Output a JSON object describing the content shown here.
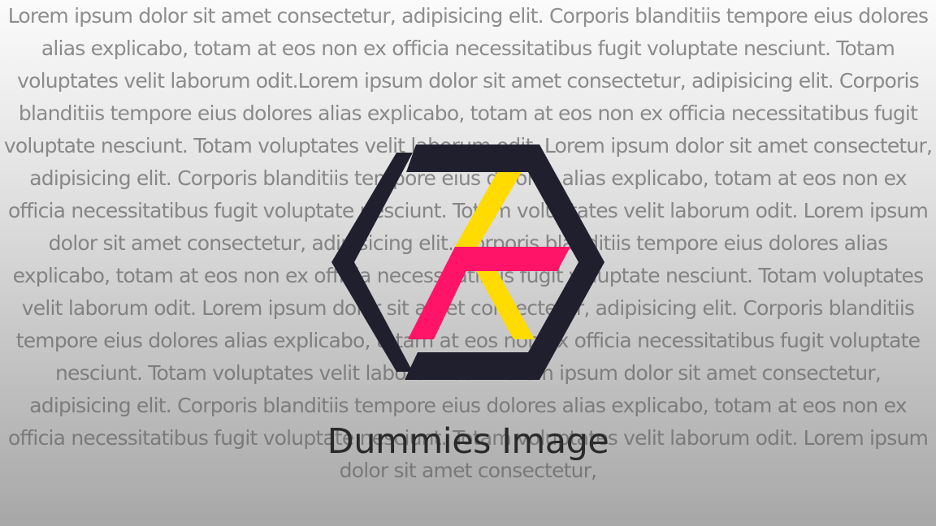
{
  "background_text": "Lorem ipsum dolor sit amet consectetur, adipisicing elit. Corporis blanditiis tempore eius dolores alias explicabo, totam at eos non ex officia necessitatibus fugit voluptate nesciunt. Totam voluptates velit laborum odit.Lorem ipsum dolor sit amet consectetur, adipisicing elit. Corporis blanditiis tempore eius dolores alias explicabo, totam at eos non ex officia necessitatibus fugit voluptate nesciunt. Totam voluptates velit laborum odit. Lorem ipsum dolor sit amet consectetur, adipisicing elit. Corporis blanditiis tempore eius dolores alias explicabo, totam at eos non ex officia necessitatibus fugit voluptate nesciunt. Totam voluptates velit laborum odit. Lorem ipsum dolor sit amet consectetur, adipisicing elit. Corporis blanditiis tempore eius dolores alias explicabo, totam at eos non ex officia necessitatibus fugit voluptate nesciunt. Totam voluptates velit laborum odit. Lorem ipsum dolor sit amet consectetur, adipisicing elit. Corporis blanditiis tempore eius dolores alias explicabo, totam at eos non ex officia necessitatibus fugit voluptate nesciunt. Totam voluptates velit laborum odit.Lorem ipsum dolor sit amet consectetur, adipisicing elit. Corporis blanditiis tempore eius dolores alias explicabo, totam at eos non ex officia necessitatibus fugit voluptate nesciunt. Totam voluptates velit laborum odit. Lorem ipsum dolor sit amet consectetur,",
  "caption": "Dummies Image",
  "logo": {
    "icon": "hexagon-logo-icon",
    "colors": {
      "dark": "#1f1f2e",
      "yellow": "#ffdb00",
      "pink": "#ff1467"
    }
  }
}
